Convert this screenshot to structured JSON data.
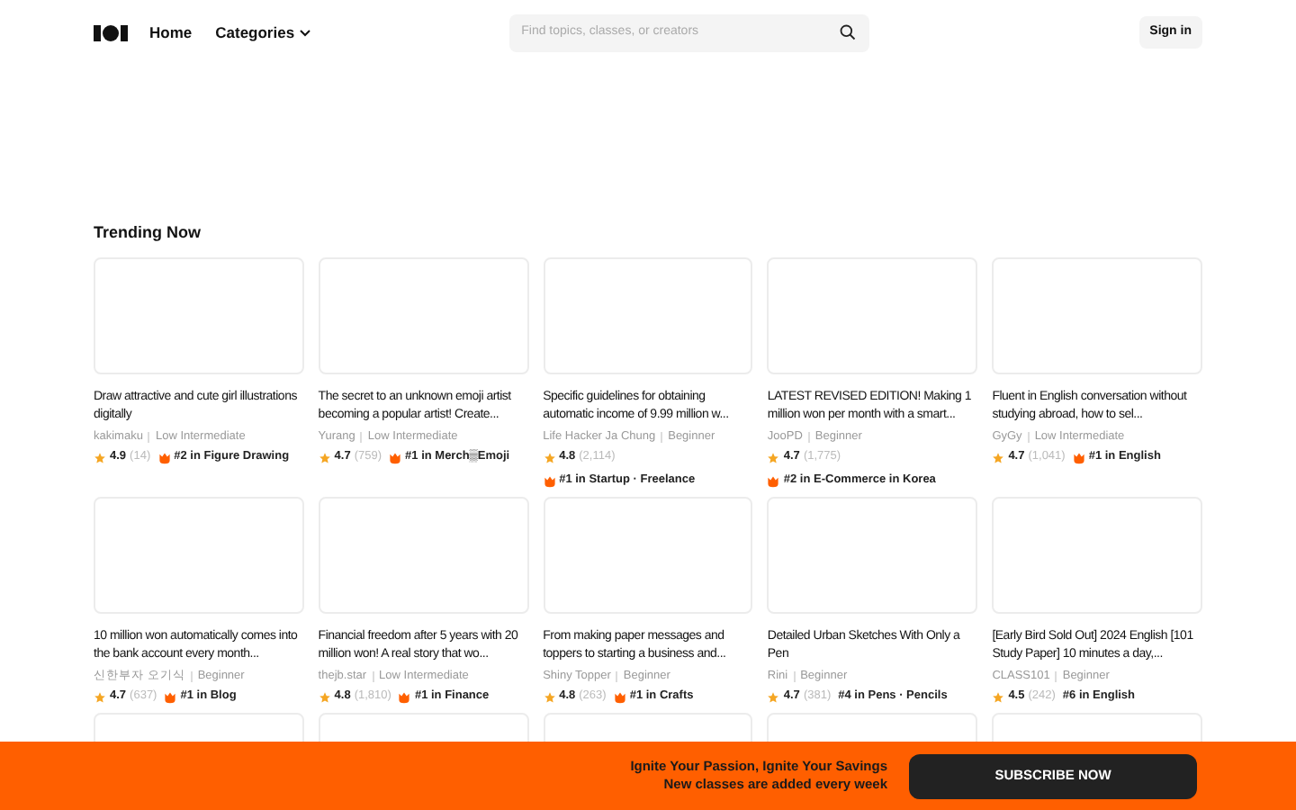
{
  "header": {
    "nav": [
      {
        "label": "Home",
        "dropdown": false
      },
      {
        "label": "Categories",
        "dropdown": true
      }
    ],
    "search": {
      "placeholder": "Find topics, classes, or creators"
    },
    "sign_in": "Sign in"
  },
  "section_title": "Trending Now",
  "classes": [
    {
      "title": "Draw attractive and cute girl illustrations digitally",
      "creator": "kakimaku",
      "level": "Low Intermediate",
      "rating": "4.9",
      "reviews": "(14)",
      "rank": "#2 in Figure Drawing",
      "hot": true
    },
    {
      "title": "The secret to an unknown emoji artist becoming a popular artist! Create...",
      "creator": "Yurang",
      "level": "Low Intermediate",
      "rating": "4.7",
      "reviews": "(759)",
      "rank": "#1 in Merch▒Emoji",
      "hot": true
    },
    {
      "title": "Specific guidelines for obtaining automatic income of 9.99 million w...",
      "creator": "Life Hacker Ja Chung",
      "level": "Beginner",
      "rating": "4.8",
      "reviews": "(2,114)",
      "rank": "#1 in Startup · Freelance",
      "hot": true
    },
    {
      "title": "LATEST REVISED EDITION! Making 1 million won per month with a smart...",
      "creator": "JooPD",
      "level": "Beginner",
      "rating": "4.7",
      "reviews": "(1,775)",
      "rank": "#2 in E-Commerce in Korea",
      "hot": true
    },
    {
      "title": "Fluent in English conversation without studying abroad, how to sel...",
      "creator": "GyGy",
      "level": "Low Intermediate",
      "rating": "4.7",
      "reviews": "(1,041)",
      "rank": "#1 in English",
      "hot": true
    },
    {
      "title": "10 million won automatically comes into the bank account every month...",
      "creator": "신한부자 오기식",
      "level": "Beginner",
      "rating": "4.7",
      "reviews": "(637)",
      "rank": "#1 in Blog",
      "hot": true
    },
    {
      "title": "Financial freedom after 5 years with 20 million won! A real story that wo...",
      "creator": "thejb.star",
      "level": "Low Intermediate",
      "rating": "4.8",
      "reviews": "(1,810)",
      "rank": "#1 in Finance",
      "hot": true
    },
    {
      "title": "From making paper messages and toppers to starting a business and...",
      "creator": "Shiny Topper",
      "level": "Beginner",
      "rating": "4.8",
      "reviews": "(263)",
      "rank": "#1 in Crafts",
      "hot": true
    },
    {
      "title": "Detailed Urban Sketches With Only a Pen",
      "creator": "Rini",
      "level": "Beginner",
      "rating": "4.7",
      "reviews": "(381)",
      "rank": "#4 in Pens · Pencils",
      "hot": false
    },
    {
      "title": "[Early Bird Sold Out] 2024 English [101 Study Paper] 10 minutes a day,...",
      "creator": "CLASS101",
      "level": "Beginner",
      "rating": "4.5",
      "reviews": "(242)",
      "rank": "#6 in English",
      "hot": false
    }
  ],
  "banner": {
    "headline": "Ignite Your Passion, Ignite Your Savings",
    "subline": "New classes are added every week",
    "button": "SUBSCRIBE NOW"
  }
}
